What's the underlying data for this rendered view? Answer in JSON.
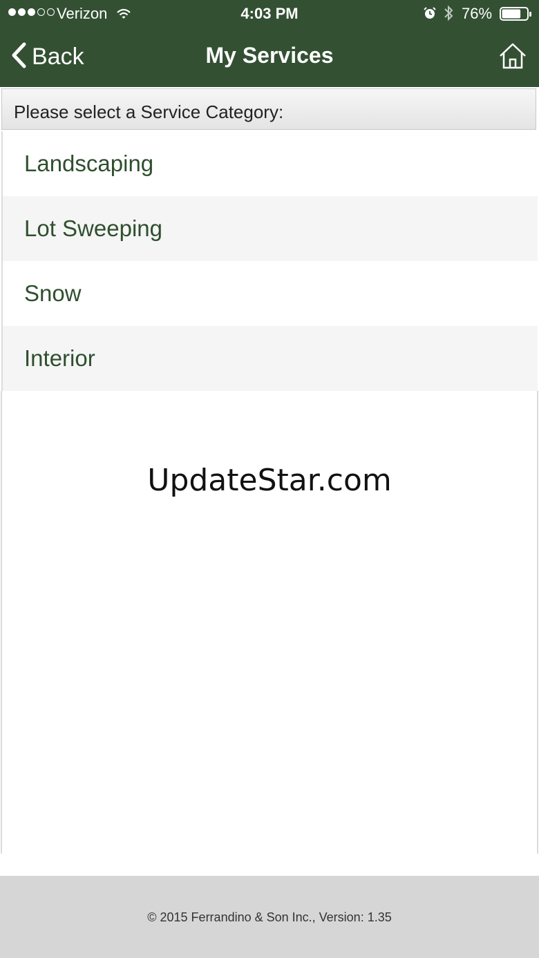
{
  "status_bar": {
    "carrier": "Verizon",
    "time": "4:03 PM",
    "battery_percent": "76%",
    "battery_level": 0.76,
    "signal_bars_filled": 3,
    "signal_bars_total": 5
  },
  "nav": {
    "back_label": "Back",
    "title": "My Services",
    "home_icon": "home-icon",
    "back_icon": "chevron-left-icon"
  },
  "section": {
    "header": "Please select a Service Category:"
  },
  "categories": [
    {
      "label": "Landscaping"
    },
    {
      "label": "Lot Sweeping"
    },
    {
      "label": "Snow"
    },
    {
      "label": "Interior"
    }
  ],
  "watermark": "UpdateStar.com",
  "footer": {
    "text": "© 2015 Ferrandino & Son Inc., Version: 1.35"
  },
  "colors": {
    "header_bg": "#335033",
    "item_text": "#2f4f2f",
    "footer_bg": "#d6d6d6"
  }
}
